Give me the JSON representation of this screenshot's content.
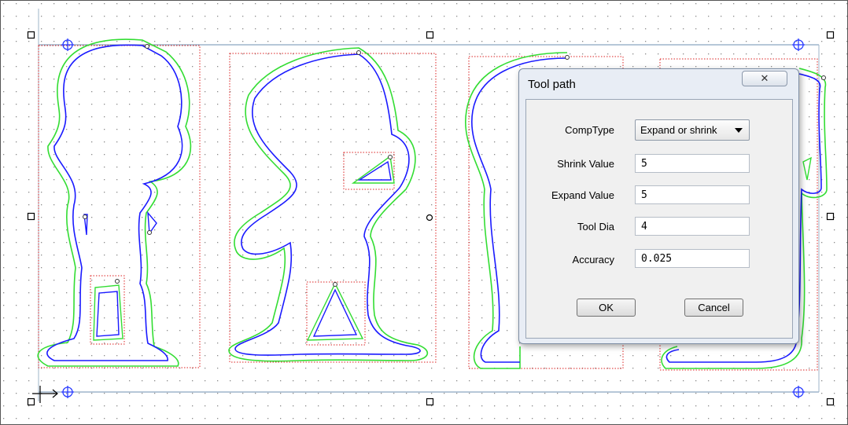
{
  "dialog": {
    "title": "Tool path",
    "close_icon": "close-icon",
    "fields": [
      {
        "label": "CompType",
        "value": "Expand or shrink",
        "kind": "select"
      },
      {
        "label": "Shrink Value",
        "value": "5"
      },
      {
        "label": "Expand Value",
        "value": "5"
      },
      {
        "label": "Tool Dia",
        "value": "4"
      },
      {
        "label": "Accuracy",
        "value": "0.025"
      }
    ],
    "ok_label": "OK",
    "cancel_label": "Cancel"
  },
  "colors": {
    "path_outline": "#0000ff",
    "offset_outline": "#33dd33",
    "bounding_box": "#dd2222",
    "grid_dot": "#888888",
    "dialog_bg": "#e8edf5"
  }
}
